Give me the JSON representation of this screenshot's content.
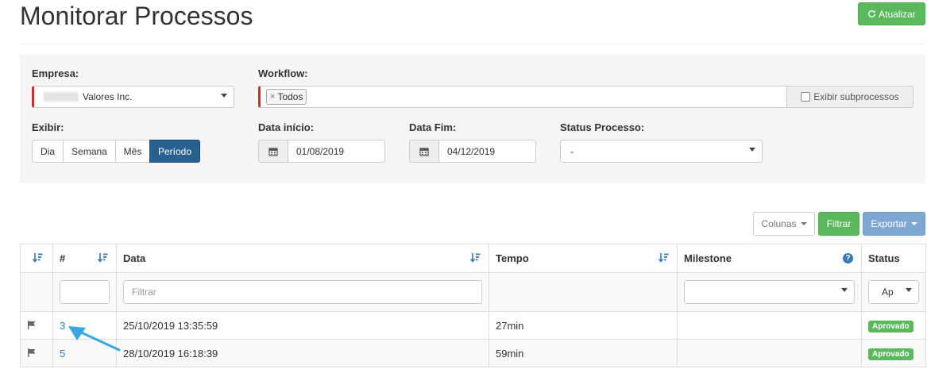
{
  "header": {
    "title": "Monitorar Processos",
    "refresh_label": "Atualizar"
  },
  "filters": {
    "empresa": {
      "label": "Empresa:",
      "value": "Valores Inc."
    },
    "workflow": {
      "label": "Workflow:",
      "tag": "Todos",
      "subprocess_label": "Exibir subprocessos"
    },
    "exibir": {
      "label": "Exibir:",
      "options": [
        "Dia",
        "Semana",
        "Mês",
        "Período"
      ],
      "active": "Período"
    },
    "data_inicio": {
      "label": "Data início:",
      "value": "01/08/2019"
    },
    "data_fim": {
      "label": "Data Fim:",
      "value": "04/12/2019"
    },
    "status_processo": {
      "label": "Status Processo:",
      "value": "-"
    }
  },
  "toolbar": {
    "columns_label": "Colunas",
    "filter_label": "Filtrar",
    "export_label": "Exportar"
  },
  "table": {
    "headers": {
      "number": "#",
      "data": "Data",
      "tempo": "Tempo",
      "milestone": "Milestone",
      "status": "Status"
    },
    "filter_placeholder": "Filtrar",
    "status_filter_value": "Ap",
    "rows": [
      {
        "id": "3",
        "data": "25/10/2019 13:35:59",
        "tempo": "27min",
        "milestone": "",
        "status": "Aprovado"
      },
      {
        "id": "5",
        "data": "28/10/2019 16:18:39",
        "tempo": "59min",
        "milestone": "",
        "status": "Aprovado"
      }
    ]
  },
  "colors": {
    "success": "#5cb85c",
    "primary": "#286090",
    "link": "#337ab7",
    "required": "#c9302c",
    "annotation_arrow": "#3aa7e0"
  },
  "icons": {
    "refresh": "refresh-icon",
    "calendar": "calendar-icon",
    "sort": "sort-desc-icon",
    "help": "question-circle-icon",
    "flag": "flag-icon"
  }
}
